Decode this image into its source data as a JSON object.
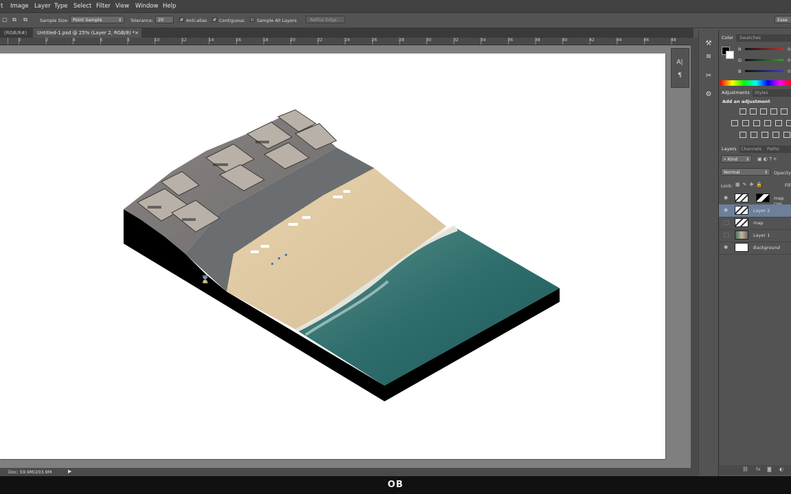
{
  "menu": [
    "t",
    "Image",
    "Layer",
    "Type",
    "Select",
    "Filter",
    "View",
    "Window",
    "Help"
  ],
  "options_bar": {
    "sample_size_label": "Sample Size:",
    "sample_size_value": "Point Sample",
    "tolerance_label": "Tolerance:",
    "tolerance_value": "20",
    "anti_alias_label": "Anti-alias",
    "contiguous_label": "Contiguous",
    "sample_all_layers_label": "Sample All Layers",
    "refine_edge_label": "Refine Edge...",
    "workspace_label": "Esse"
  },
  "tabs": [
    {
      "label": "(RGB/8#)",
      "active": false
    },
    {
      "label": "Untitled-1.psd @ 25% (Layer 2, RGB/8) *",
      "active": true
    }
  ],
  "ruler_numbers": [
    "2",
    "0",
    "2",
    "4",
    "6",
    "8",
    "10",
    "12",
    "14",
    "16",
    "18",
    "20",
    "22",
    "24",
    "26",
    "28",
    "30",
    "32",
    "34",
    "36",
    "38",
    "40",
    "42",
    "44",
    "46",
    "48",
    "50"
  ],
  "status": {
    "doc_size": "Doc: 59.9M/203.9M"
  },
  "color_panel": {
    "tabs": [
      "Color",
      "Swatches"
    ],
    "channels": [
      {
        "name": "R",
        "value": "0",
        "color": "#c03030"
      },
      {
        "name": "G",
        "value": "0",
        "color": "#30a030"
      },
      {
        "name": "B",
        "value": "0",
        "color": "#3040c0"
      }
    ]
  },
  "adjustments_panel": {
    "tabs": [
      "Adjustments",
      "Styles"
    ],
    "heading": "Add an adjustment"
  },
  "layers_panel": {
    "tabs": [
      "Layers",
      "Channels",
      "Paths"
    ],
    "filter_kind": "Kind",
    "blend_mode": "Normal",
    "opacity_label": "Opacity:",
    "lock_label": "Lock:",
    "fill_label": "Fill:",
    "layers": [
      {
        "name": "map cop",
        "visible": true,
        "selected": false,
        "italic": false
      },
      {
        "name": "Layer 2",
        "visible": true,
        "selected": true,
        "italic": false
      },
      {
        "name": "map",
        "visible": false,
        "selected": false,
        "italic": false
      },
      {
        "name": "Layer 1",
        "visible": false,
        "selected": false,
        "italic": false
      },
      {
        "name": "Background",
        "visible": true,
        "selected": false,
        "italic": true
      }
    ]
  },
  "watermark": "OB"
}
